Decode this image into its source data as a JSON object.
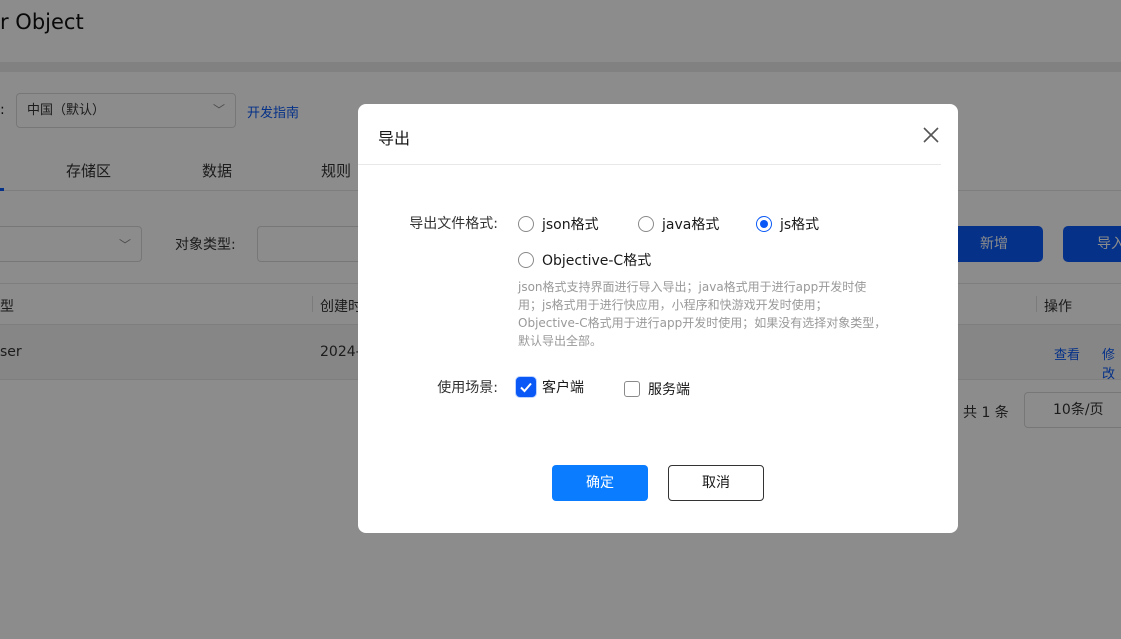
{
  "background": {
    "title": "r Object",
    "region_label": ":",
    "region_value": "中国（默认）",
    "dev_guide": "开发指南",
    "tabs": [
      "存储区",
      "数据",
      "规则"
    ],
    "object_type_label": "对象类型:",
    "new_button": "新增",
    "import_button": "导入",
    "table": {
      "headers": [
        "型",
        "创建时",
        "操作"
      ],
      "row": {
        "type": "ser",
        "created": "2024-",
        "view": "查看",
        "edit": "修改"
      }
    },
    "total": "共 1 条",
    "page_size": "10条/页"
  },
  "dialog": {
    "title": "导出",
    "format_label": "导出文件格式:",
    "formats": [
      {
        "label": "json格式",
        "checked": false
      },
      {
        "label": "java格式",
        "checked": false
      },
      {
        "label": "js格式",
        "checked": true
      },
      {
        "label": "Objective-C格式",
        "checked": false
      }
    ],
    "help_lines": [
      "json格式支持界面进行导入导出；java格式用于进行app开发时使",
      "用；js格式用于进行快应用，小程序和快游戏开发时使用；",
      "Objective-C格式用于进行app开发时使用；如果没有选择对象类型，",
      "默认导出全部。"
    ],
    "scene_label": "使用场景:",
    "scenes": [
      {
        "label": "客户端",
        "checked": true
      },
      {
        "label": "服务端",
        "checked": false
      }
    ],
    "confirm": "确定",
    "cancel": "取消"
  },
  "colors": {
    "accent": "#0a59f7",
    "primary_button": "#0a7cff",
    "overlay": "rgba(0,0,0,0.45)"
  }
}
